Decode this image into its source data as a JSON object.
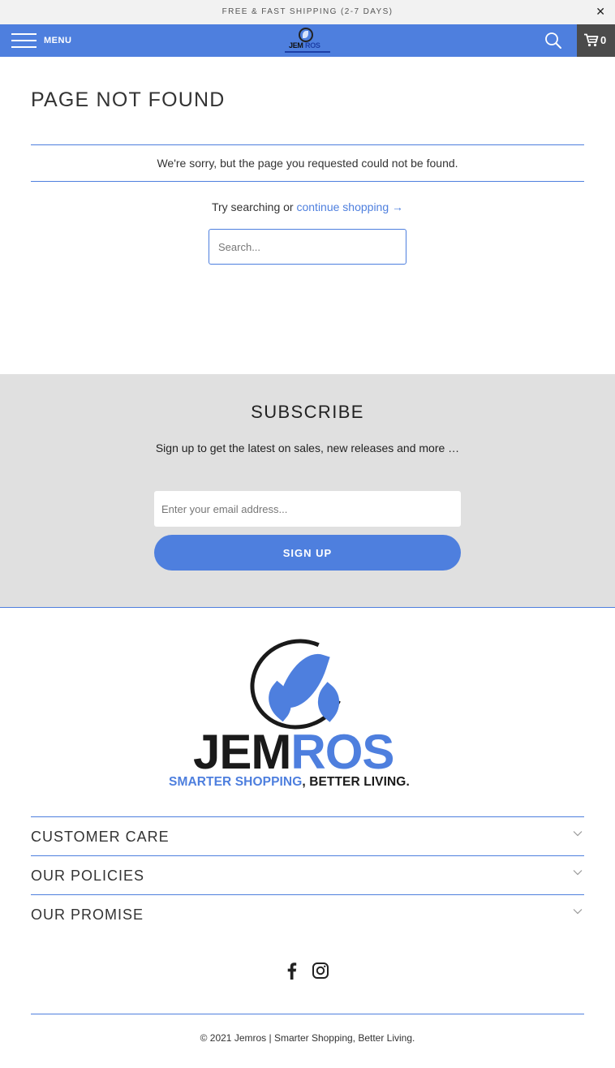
{
  "announcement": {
    "text": "FREE & FAST SHIPPING (2-7 DAYS)",
    "close_glyph": "✕"
  },
  "header": {
    "menu_label": "MENU",
    "logo_text_part1": "JEM",
    "logo_text_part2": "ROS",
    "cart_count": "0",
    "colors": {
      "bar": "#4e7fde",
      "cart_bg": "#4b4b4b"
    }
  },
  "not_found": {
    "title": "PAGE NOT FOUND",
    "message": "We're sorry, but the page you requested could not be found.",
    "try_text": "Try searching or",
    "continue_link": "continue shopping →",
    "search_placeholder": "Search..."
  },
  "subscribe": {
    "title": "SUBSCRIBE",
    "text": "Sign up to get the latest on sales, new releases and more …",
    "email_placeholder": "Enter your email address...",
    "button_label": "SIGN UP"
  },
  "footer_logo": {
    "word_part1": "JEM",
    "word_part2": "ROS",
    "tagline_part1": "SMARTER SHOPPING",
    "tagline_part2": ", BETTER LIVING."
  },
  "footer_sections": [
    {
      "label": "CUSTOMER CARE",
      "icon": "chevron-down-icon"
    },
    {
      "label": "OUR POLICIES",
      "icon": "chevron-down-icon"
    },
    {
      "label": "OUR PROMISE",
      "icon": "chevron-down-icon"
    }
  ],
  "social": [
    "facebook-icon",
    "instagram-icon"
  ],
  "copyright": "© 2021 Jemros | Smarter Shopping, Better Living.",
  "colors": {
    "accent": "#4e7fde",
    "subscribe_bg": "#e0e0e0",
    "announce_bg": "#f2f2f2"
  }
}
